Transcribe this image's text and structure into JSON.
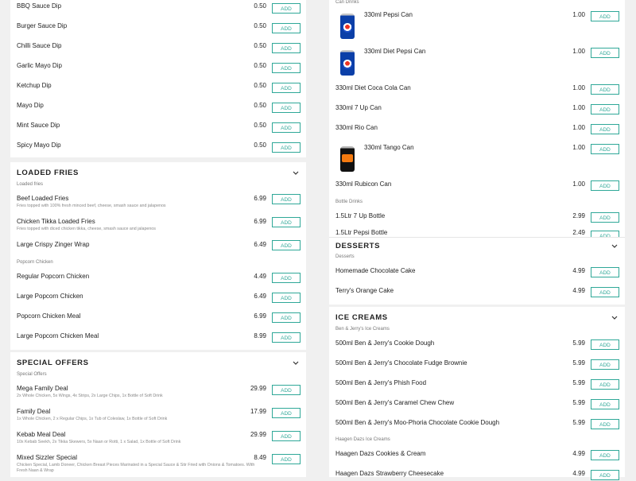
{
  "left": {
    "dips": [
      {
        "name": "BBQ Sauce Dip",
        "price": "0.50"
      },
      {
        "name": "Burger Sauce Dip",
        "price": "0.50"
      },
      {
        "name": "Chilli Sauce Dip",
        "price": "0.50"
      },
      {
        "name": "Garlic Mayo Dip",
        "price": "0.50"
      },
      {
        "name": "Ketchup Dip",
        "price": "0.50"
      },
      {
        "name": "Mayo Dip",
        "price": "0.50"
      },
      {
        "name": "Mint Sauce Dip",
        "price": "0.50"
      },
      {
        "name": "Spicy Mayo Dip",
        "price": "0.50"
      }
    ],
    "loaded_fries": {
      "title": "LOADED FRIES",
      "sub1": "Loaded fries",
      "items": [
        {
          "name": "Beef Loaded Fries",
          "desc": "Fries topped with 100% fresh minced beef, cheese, smash sauce and jalapenos",
          "price": "6.99"
        },
        {
          "name": "Chicken Tikka Loaded Fries",
          "desc": "Fries topped with diced chicken tikka, cheese, smash sauce and jalapenos",
          "price": "6.99"
        },
        {
          "name": "Large Crispy Zinger Wrap",
          "desc": "",
          "price": "6.49"
        }
      ],
      "sub2": "Popcorn Chicken",
      "popcorn": [
        {
          "name": "Regular Popcorn Chicken",
          "price": "4.49"
        },
        {
          "name": "Large Popcorn Chicken",
          "price": "6.49"
        },
        {
          "name": "Popcorn Chicken Meal",
          "price": "6.99"
        },
        {
          "name": "Large Popcorn Chicken Meal",
          "price": "8.99"
        }
      ]
    },
    "special_offers": {
      "title": "SPECIAL OFFERS",
      "sub": "Special Offers",
      "items": [
        {
          "name": "Mega Family Deal",
          "desc": "2x Whole Chicken, 5x Wings, 4x Strips, 2x Large Chips, 1x Bottle of Soft Drink",
          "price": "29.99"
        },
        {
          "name": "Family Deal",
          "desc": "1x Whole Chicken, 2 x Regular Chips, 1x Tub of Coleslaw, 1x Bottle of Soft Drink",
          "price": "17.99"
        },
        {
          "name": "Kebab Meal Deal",
          "desc": "10x Kebab Seekh, 2x Tikka Skewers, 5x Naan or Rotti, 1 x Salad, 1x Bottle of Soft Drink",
          "price": "29.99"
        },
        {
          "name": "Mixed Sizzler Special",
          "desc": "Chicken Special, Lamb Doneer, Chicken Breast Pieces Marinated in a Special Sauce & Stir Fried with Onions & Tomatoes. With",
          "desc2": "Fresh Naan & Wrap",
          "price": "8.49"
        }
      ]
    }
  },
  "right": {
    "can_drinks": {
      "sub": "Can Drinks",
      "items": [
        {
          "name": "330ml Pepsi Can",
          "price": "1.00",
          "image": "pepsi-can"
        },
        {
          "name": "330ml Diet Pepsi Can",
          "price": "1.00",
          "image": "pepsi-can"
        },
        {
          "name": "330ml Diet Coca Cola Can",
          "price": "1.00"
        },
        {
          "name": "330ml 7 Up Can",
          "price": "1.00"
        },
        {
          "name": "330ml Rio Can",
          "price": "1.00"
        },
        {
          "name": "330ml Tango Can",
          "price": "1.00",
          "image": "tango-can"
        },
        {
          "name": "330ml Rubicon Can",
          "price": "1.00"
        }
      ],
      "bottle_sub": "Bottle Drinks",
      "bottles": [
        {
          "name": "1.5Ltr 7 Up Bottle",
          "price": "2.99"
        },
        {
          "name": "1.5Ltr Pepsi Bottle",
          "price": "2.49"
        }
      ]
    },
    "desserts": {
      "title": "DESSERTS",
      "sub": "Desserts",
      "items": [
        {
          "name": "Homemade Chocolate Cake",
          "price": "4.99"
        },
        {
          "name": "Terry's Orange Cake",
          "price": "4.99"
        }
      ]
    },
    "ice_creams": {
      "title": "ICE CREAMS",
      "sub1": "Ben & Jerry's Ice Creams",
      "items": [
        {
          "name": "500ml Ben & Jerry's Cookie Dough",
          "price": "5.99"
        },
        {
          "name": "500ml Ben & Jerry's Chocolate Fudge Brownie",
          "price": "5.99"
        },
        {
          "name": "500ml Ben & Jerry's Phish Food",
          "price": "5.99"
        },
        {
          "name": "500ml Ben & Jerry's Caramel Chew Chew",
          "price": "5.99"
        },
        {
          "name": "500ml Ben & Jerry's Moo-Phoria Chocolate Cookie Dough",
          "price": "5.99"
        }
      ],
      "sub2": "Haagen Dazs Ice Creams",
      "haagen": [
        {
          "name": "Haagen Dazs Cookies & Cream",
          "price": "4.99"
        },
        {
          "name": "Haagen Dazs Strawberry Cheesecake",
          "price": "4.99"
        }
      ]
    }
  },
  "add_label": "ADD",
  "colors": {
    "accent": "#2fa898",
    "background": "#f0f0f0",
    "panel": "#ffffff"
  }
}
